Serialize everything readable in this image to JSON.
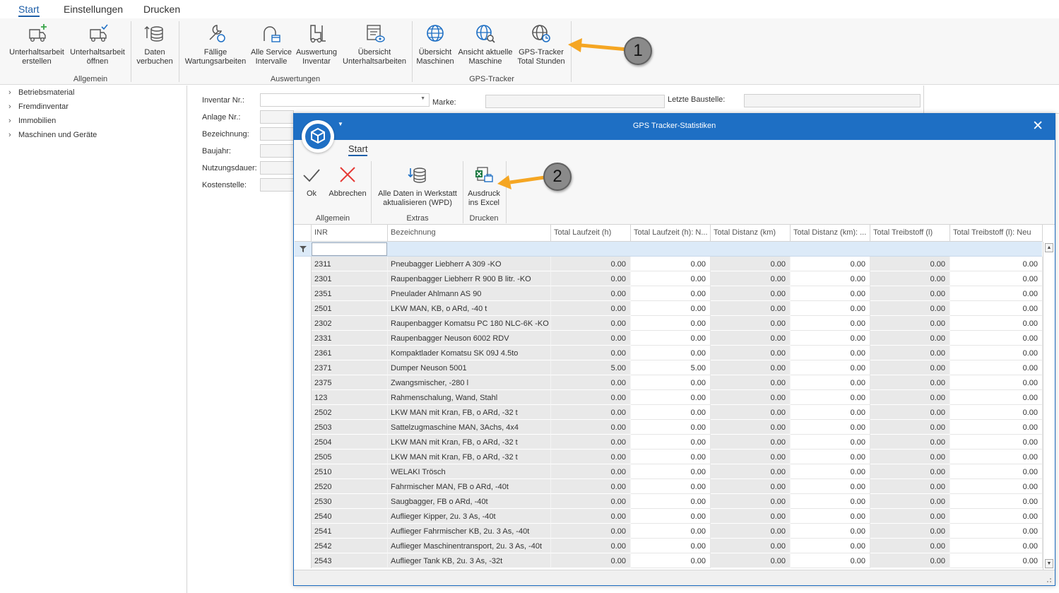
{
  "main_tabs": [
    "Start",
    "Einstellungen",
    "Drucken"
  ],
  "ribbon": {
    "buttons": [
      {
        "l1": "Unterhaltsarbeit",
        "l2": "erstellen"
      },
      {
        "l1": "Unterhaltsarbeit",
        "l2": "öffnen"
      },
      {
        "l1": "Daten",
        "l2": "verbuchen"
      },
      {
        "l1": "Fällige",
        "l2": "Wartungsarbeiten"
      },
      {
        "l1": "Alle Service",
        "l2": "Intervalle"
      },
      {
        "l1": "Auswertung",
        "l2": "Inventar"
      },
      {
        "l1": "Übersicht",
        "l2": "Unterhaltsarbeiten"
      },
      {
        "l1": "Übersicht",
        "l2": "Maschinen"
      },
      {
        "l1": "Ansicht aktuelle",
        "l2": "Maschine"
      },
      {
        "l1": "GPS-Tracker",
        "l2": "Total Stunden"
      }
    ],
    "groups": [
      "Allgemein",
      "Auswertungen",
      "GPS-Tracker"
    ]
  },
  "tree": [
    "Betriebsmaterial",
    "Fremdinventar",
    "Immobilien",
    "Maschinen und Geräte"
  ],
  "form": {
    "labels": [
      "Inventar Nr.:",
      "Anlage Nr.:",
      "Bezeichnung:",
      "Baujahr:",
      "Nutzungsdauer:",
      "Kostenstelle:"
    ],
    "marke": "Marke:",
    "letzte_baustelle": "Letzte Baustelle:"
  },
  "dialog": {
    "title": "GPS Tracker-Statistiken",
    "tab": "Start",
    "buttons": {
      "ok": "Ok",
      "abbrechen": "Abbrechen",
      "alle_l1": "Alle Daten in Werkstatt",
      "alle_l2": "aktualisieren (WPD)",
      "excel_l1": "Ausdruck",
      "excel_l2": "ins Excel"
    },
    "groups": [
      "Allgemein",
      "Extras",
      "Drucken"
    ],
    "columns": [
      "INR",
      "Bezeichnung",
      "Total Laufzeit (h)",
      "Total Laufzeit (h): N...",
      "Total Distanz (km)",
      "Total Distanz (km): ...",
      "Total Treibstoff (l)",
      "Total Treibstoff (l): Neu"
    ],
    "rows": [
      [
        "2311",
        "Pneubagger Liebherr A 309 -KO",
        "0.00",
        "0.00",
        "0.00",
        "0.00",
        "0.00",
        "0.00"
      ],
      [
        "2301",
        "Raupenbagger Liebherr R 900 B litr. -KO",
        "0.00",
        "0.00",
        "0.00",
        "0.00",
        "0.00",
        "0.00"
      ],
      [
        "2351",
        "Pneulader Ahlmann AS 90",
        "0.00",
        "0.00",
        "0.00",
        "0.00",
        "0.00",
        "0.00"
      ],
      [
        "2501",
        "LKW MAN, KB, o ARd, -40 t",
        "0.00",
        "0.00",
        "0.00",
        "0.00",
        "0.00",
        "0.00"
      ],
      [
        "2302",
        "Raupenbagger Komatsu PC 180 NLC-6K -KO",
        "0.00",
        "0.00",
        "0.00",
        "0.00",
        "0.00",
        "0.00"
      ],
      [
        "2331",
        "Raupenbagger Neuson 6002 RDV",
        "0.00",
        "0.00",
        "0.00",
        "0.00",
        "0.00",
        "0.00"
      ],
      [
        "2361",
        "Kompaktlader Komatsu SK 09J 4.5to",
        "0.00",
        "0.00",
        "0.00",
        "0.00",
        "0.00",
        "0.00"
      ],
      [
        "2371",
        "Dumper Neuson 5001",
        "5.00",
        "5.00",
        "0.00",
        "0.00",
        "0.00",
        "0.00"
      ],
      [
        "2375",
        "Zwangsmischer, -280 l",
        "0.00",
        "0.00",
        "0.00",
        "0.00",
        "0.00",
        "0.00"
      ],
      [
        "123",
        "Rahmenschalung, Wand, Stahl",
        "0.00",
        "0.00",
        "0.00",
        "0.00",
        "0.00",
        "0.00"
      ],
      [
        "2502",
        "LKW MAN mit Kran, FB, o ARd, -32 t",
        "0.00",
        "0.00",
        "0.00",
        "0.00",
        "0.00",
        "0.00"
      ],
      [
        "2503",
        "Sattelzugmaschine MAN, 3Achs, 4x4",
        "0.00",
        "0.00",
        "0.00",
        "0.00",
        "0.00",
        "0.00"
      ],
      [
        "2504",
        "LKW MAN mit Kran, FB, o ARd, -32 t",
        "0.00",
        "0.00",
        "0.00",
        "0.00",
        "0.00",
        "0.00"
      ],
      [
        "2505",
        "LKW MAN mit Kran, FB, o ARd, -32 t",
        "0.00",
        "0.00",
        "0.00",
        "0.00",
        "0.00",
        "0.00"
      ],
      [
        "2510",
        "WELAKI Trösch",
        "0.00",
        "0.00",
        "0.00",
        "0.00",
        "0.00",
        "0.00"
      ],
      [
        "2520",
        "Fahrmischer MAN, FB o ARd, -40t",
        "0.00",
        "0.00",
        "0.00",
        "0.00",
        "0.00",
        "0.00"
      ],
      [
        "2530",
        "Saugbagger, FB o ARd, -40t",
        "0.00",
        "0.00",
        "0.00",
        "0.00",
        "0.00",
        "0.00"
      ],
      [
        "2540",
        "Auflieger Kipper, 2u. 3 As, -40t",
        "0.00",
        "0.00",
        "0.00",
        "0.00",
        "0.00",
        "0.00"
      ],
      [
        "2541",
        "Auflieger Fahrmischer KB, 2u. 3 As, -40t",
        "0.00",
        "0.00",
        "0.00",
        "0.00",
        "0.00",
        "0.00"
      ],
      [
        "2542",
        "Auflieger Maschinentransport, 2u. 3 As, -40t",
        "0.00",
        "0.00",
        "0.00",
        "0.00",
        "0.00",
        "0.00"
      ],
      [
        "2543",
        "Auflieger Tank KB, 2u. 3 As, -32t",
        "0.00",
        "0.00",
        "0.00",
        "0.00",
        "0.00",
        "0.00"
      ]
    ]
  },
  "callouts": [
    "1",
    "2"
  ],
  "colors": {
    "accent": "#1e6fc4",
    "arrow": "#f5a623",
    "callout": "#8a8a8a"
  }
}
